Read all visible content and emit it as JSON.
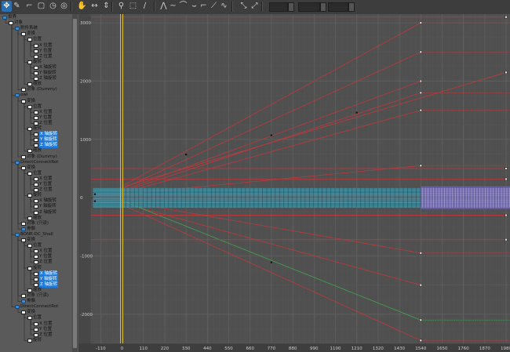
{
  "toolbar": {
    "buttons": [
      {
        "name": "move-keys-icon",
        "glyph": "✥",
        "active": true
      },
      {
        "name": "draw-curves-icon",
        "glyph": "✎"
      },
      {
        "name": "insert-keys-icon",
        "glyph": "⌐"
      },
      {
        "name": "region-tool-icon",
        "glyph": "▢"
      },
      {
        "name": "retime-icon",
        "glyph": "◷"
      },
      {
        "name": "retime-all-icon",
        "glyph": "◎"
      },
      {
        "name": "pan-hand-icon",
        "glyph": "✋"
      },
      {
        "name": "frame-horizontal-icon",
        "glyph": "↔"
      },
      {
        "name": "frame-value-icon",
        "glyph": "⇕"
      },
      {
        "name": "zoom-icon",
        "glyph": "⚲"
      },
      {
        "name": "zoom-region-icon",
        "glyph": "⬚"
      },
      {
        "name": "isolate-curve-icon",
        "glyph": "∕"
      },
      {
        "name": "tangent-auto-icon",
        "glyph": "⋀"
      },
      {
        "name": "tangent-spline-icon",
        "glyph": "∼"
      },
      {
        "name": "tangent-fast-icon",
        "glyph": "⌒"
      },
      {
        "name": "tangent-slow-icon",
        "glyph": "⌣"
      },
      {
        "name": "tangent-step-icon",
        "glyph": "⌐"
      },
      {
        "name": "tangent-linear-icon",
        "glyph": "⟋"
      },
      {
        "name": "tangent-smooth-icon",
        "glyph": "∿"
      },
      {
        "name": "show-tangents-icon",
        "glyph": "⤡"
      },
      {
        "name": "lock-tangents-icon",
        "glyph": "⤢"
      }
    ]
  },
  "tree": {
    "rows": [
      {
        "label": "世界",
        "indent": 0,
        "icon": "blue"
      },
      {
        "label": "对象",
        "indent": 1,
        "icon": "white"
      },
      {
        "label": "附件系统",
        "indent": 2,
        "icon": "blue"
      },
      {
        "label": "变换",
        "indent": 3,
        "icon": "white"
      },
      {
        "label": "位置",
        "indent": 4,
        "icon": "white"
      },
      {
        "label": "X 位置",
        "indent": 5,
        "icon": "white"
      },
      {
        "label": "Y 位置",
        "indent": 5,
        "icon": "white"
      },
      {
        "label": "Z 位置",
        "indent": 5,
        "icon": "white"
      },
      {
        "label": "旋转",
        "indent": 4,
        "icon": "white"
      },
      {
        "label": "X 轴旋转",
        "indent": 5,
        "icon": "white"
      },
      {
        "label": "Y 轴旋转",
        "indent": 5,
        "icon": "white"
      },
      {
        "label": "Z 轴旋转",
        "indent": 5,
        "icon": "white"
      },
      {
        "label": "缩放",
        "indent": 4,
        "icon": "white"
      },
      {
        "label": "对象 (Dummy)",
        "indent": 3,
        "icon": "white"
      },
      {
        "label": "owl",
        "indent": 2,
        "icon": "blue"
      },
      {
        "label": "变换",
        "indent": 3,
        "icon": "white"
      },
      {
        "label": "位置",
        "indent": 4,
        "icon": "white"
      },
      {
        "label": "X 位置",
        "indent": 5,
        "icon": "white"
      },
      {
        "label": "Y 位置",
        "indent": 5,
        "icon": "white"
      },
      {
        "label": "Z 位置",
        "indent": 5,
        "icon": "white"
      },
      {
        "label": "旋转",
        "indent": 4,
        "icon": "white"
      },
      {
        "label": "X 轴旋转",
        "indent": 5,
        "icon": "white",
        "sel": true
      },
      {
        "label": "Y 轴旋转",
        "indent": 5,
        "icon": "white",
        "sel": true
      },
      {
        "label": "Z 轴旋转",
        "indent": 5,
        "icon": "white",
        "sel": true
      },
      {
        "label": "缩放",
        "indent": 4,
        "icon": "white"
      },
      {
        "label": "对象 (Dummy)",
        "indent": 3,
        "icon": "white"
      },
      {
        "label": "DirectConnectRot",
        "indent": 2,
        "icon": "blue"
      },
      {
        "label": "变换",
        "indent": 3,
        "icon": "white"
      },
      {
        "label": "位置",
        "indent": 4,
        "icon": "white"
      },
      {
        "label": "X 位置",
        "indent": 5,
        "icon": "white"
      },
      {
        "label": "Y 位置",
        "indent": 5,
        "icon": "white"
      },
      {
        "label": "Z 位置",
        "indent": 5,
        "icon": "white"
      },
      {
        "label": "旋转",
        "indent": 4,
        "icon": "white"
      },
      {
        "label": "X 轴旋转",
        "indent": 5,
        "icon": "white"
      },
      {
        "label": "Y 轴旋转",
        "indent": 5,
        "icon": "white"
      },
      {
        "label": "Z 轴旋转",
        "indent": 5,
        "icon": "white"
      },
      {
        "label": "缩放",
        "indent": 4,
        "icon": "white"
      },
      {
        "label": "对象 (只读)",
        "indent": 3,
        "icon": "white"
      },
      {
        "label": "骨骼",
        "indent": 3,
        "icon": "blue"
      },
      {
        "label": "BONE-DC_Shell",
        "indent": 2,
        "icon": "blue"
      },
      {
        "label": "变换",
        "indent": 3,
        "icon": "white"
      },
      {
        "label": "位置",
        "indent": 4,
        "icon": "white"
      },
      {
        "label": "X 位置",
        "indent": 5,
        "icon": "white"
      },
      {
        "label": "Y 位置",
        "indent": 5,
        "icon": "white"
      },
      {
        "label": "Z 位置",
        "indent": 5,
        "icon": "white"
      },
      {
        "label": "旋转",
        "indent": 4,
        "icon": "white"
      },
      {
        "label": "X 轴旋转",
        "indent": 5,
        "icon": "white",
        "sel": true
      },
      {
        "label": "Y 轴旋转",
        "indent": 5,
        "icon": "white",
        "sel": true
      },
      {
        "label": "Z 轴旋转",
        "indent": 5,
        "icon": "white",
        "sel": true
      },
      {
        "label": "缩放",
        "indent": 4,
        "icon": "white"
      },
      {
        "label": "对象 (只读)",
        "indent": 3,
        "icon": "white"
      },
      {
        "label": "骨骼",
        "indent": 3,
        "icon": "blue"
      },
      {
        "label": "DirectConnectRot",
        "indent": 2,
        "icon": "blue"
      },
      {
        "label": "变换",
        "indent": 3,
        "icon": "white"
      },
      {
        "label": "位置",
        "indent": 4,
        "icon": "white"
      },
      {
        "label": "X 位置",
        "indent": 5,
        "icon": "white"
      },
      {
        "label": "Y 位置",
        "indent": 5,
        "icon": "white"
      },
      {
        "label": "Z 位置",
        "indent": 5,
        "icon": "white"
      },
      {
        "label": "旋转",
        "indent": 4,
        "icon": "white"
      }
    ]
  },
  "graph": {
    "x_ticks": [
      "-110",
      "0",
      "110",
      "220",
      "330",
      "440",
      "550",
      "660",
      "770",
      "880",
      "990",
      "1100",
      "1210",
      "1320",
      "1430",
      "1540",
      "1650",
      "1760",
      "1870",
      "1980"
    ],
    "x_values": [
      -110,
      0,
      110,
      220,
      330,
      440,
      550,
      660,
      770,
      880,
      990,
      1100,
      1210,
      1320,
      1430,
      1540,
      1650,
      1760,
      1870,
      1980
    ],
    "y_ticks": [
      "3000",
      "2000",
      "1000",
      "0",
      "-1000",
      "-2000"
    ],
    "y_values": [
      3000,
      2000,
      1000,
      0,
      -1000,
      -2000
    ],
    "x_range": [
      -160,
      2000
    ],
    "y_range": [
      -2500,
      3150
    ],
    "current_frame": 0,
    "colors": {
      "bg": "#505050",
      "grid": "#5e5e5e",
      "text": "#cfcfcf",
      "red": "#c0393b",
      "green": "#3fa34d",
      "timeline": "#e3c21a",
      "cyan": "#36c3d6",
      "purple": "#8a7ad6"
    },
    "curves": [
      {
        "color": "red",
        "from": [
          0,
          200
        ],
        "to": [
          1540,
          3000
        ]
      },
      {
        "color": "red",
        "from": [
          0,
          150
        ],
        "to": [
          1540,
          2500
        ]
      },
      {
        "color": "red",
        "from": [
          0,
          120
        ],
        "to": [
          1540,
          2000
        ]
      },
      {
        "color": "red",
        "from": [
          0,
          100
        ],
        "to": [
          1540,
          1800
        ]
      },
      {
        "color": "red",
        "from": [
          0,
          80
        ],
        "to": [
          1540,
          1500
        ]
      },
      {
        "color": "red",
        "from": [
          0,
          180
        ],
        "to": [
          1980,
          2150
        ]
      },
      {
        "color": "red",
        "from": [
          0,
          60
        ],
        "to": [
          1540,
          550
        ]
      },
      {
        "color": "red",
        "from": [
          0,
          -60
        ],
        "to": [
          1540,
          -950
        ]
      },
      {
        "color": "red",
        "from": [
          0,
          -90
        ],
        "to": [
          1540,
          -1500
        ]
      },
      {
        "color": "red",
        "from": [
          0,
          -120
        ],
        "to": [
          1540,
          -2450
        ]
      },
      {
        "color": "green",
        "from": [
          0,
          -50
        ],
        "to": [
          1540,
          -2100
        ]
      },
      {
        "color": "red",
        "from": [
          -160,
          500
        ],
        "to": [
          1980,
          500
        ]
      },
      {
        "color": "red",
        "from": [
          -160,
          320
        ],
        "to": [
          1980,
          320
        ]
      },
      {
        "color": "red",
        "from": [
          -160,
          -300
        ],
        "to": [
          1980,
          -300
        ]
      },
      {
        "color": "red",
        "from": [
          -160,
          -720
        ],
        "to": [
          1980,
          -720
        ]
      },
      {
        "color": "red",
        "from": [
          -160,
          3100
        ],
        "to": [
          1980,
          3100
        ]
      }
    ],
    "flat_tails": [
      {
        "color": "red",
        "y": 3000
      },
      {
        "color": "red",
        "y": 2500
      },
      {
        "color": "red",
        "y": 2000
      },
      {
        "color": "red",
        "y": 1800
      },
      {
        "color": "red",
        "y": 1500
      },
      {
        "color": "red",
        "y": 550
      },
      {
        "color": "red",
        "y": -950
      },
      {
        "color": "red",
        "y": -1500
      },
      {
        "color": "red",
        "y": -2450
      },
      {
        "color": "green",
        "y": -2100
      }
    ]
  }
}
